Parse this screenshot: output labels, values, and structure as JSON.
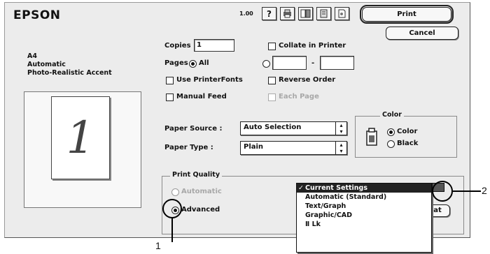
{
  "header": {
    "brand": "EPSON",
    "version": "1.00"
  },
  "toolbar": {
    "icons": [
      "help-icon",
      "printer-status-icon",
      "layout-icon",
      "media-icon",
      "background-icon"
    ],
    "help_glyph": "?",
    "print_label": "Print",
    "cancel_label": "Cancel"
  },
  "preview": {
    "lines": [
      "A4",
      "Automatic",
      "Photo-Realistic Accent"
    ],
    "page_number": "1"
  },
  "copies": {
    "label": "Copies :",
    "value": "1",
    "collate_label": "Collate in Printer"
  },
  "pages": {
    "label": "Pages :",
    "all_label": "All",
    "dash": "-",
    "from_value": "",
    "to_value": ""
  },
  "options": {
    "use_printer_fonts": "Use PrinterFonts",
    "reverse_order": "Reverse Order",
    "manual_feed": "Manual Feed",
    "each_page": "Each Page"
  },
  "paper_source": {
    "label": "Paper Source :",
    "value": "Auto Selection"
  },
  "paper_type": {
    "label": "Paper Type :",
    "value": "Plain"
  },
  "color_group": {
    "title": "Color",
    "color_label": "Color",
    "black_label": "Black"
  },
  "print_quality": {
    "title": "Print Quality",
    "automatic_label": "Automatic",
    "advanced_label": "Advanced",
    "settings_value": "Current Settings",
    "hidden_button_label": "at"
  },
  "dropdown": {
    "check": "✓",
    "items": [
      "Current Settings",
      "Automatic (Standard)",
      "Text/Graph",
      "Graphic/CAD",
      "Ⅱ Lk"
    ]
  },
  "callouts": {
    "one": "1",
    "two": "2"
  },
  "colors": {
    "dialog_bg": "#ececec",
    "selected_bg": "#222222"
  }
}
